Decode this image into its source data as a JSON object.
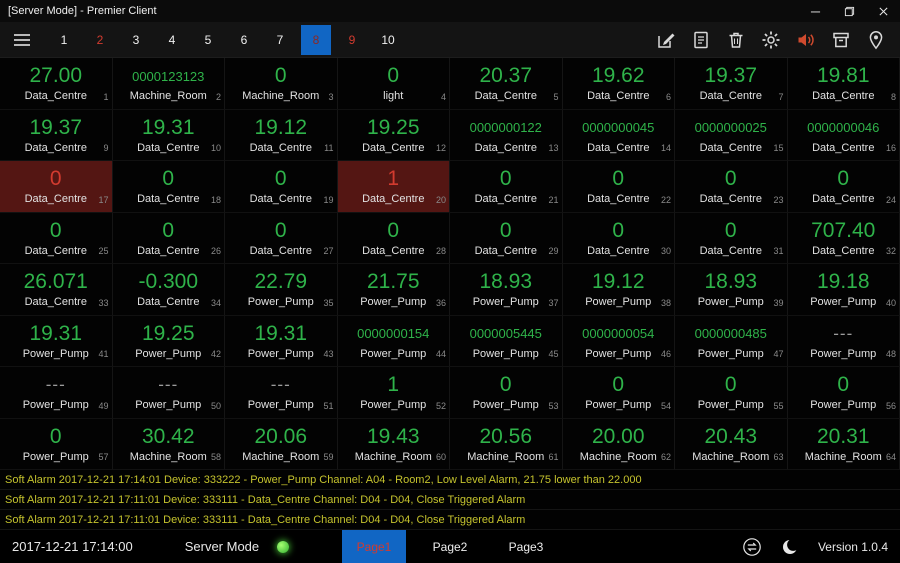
{
  "window": {
    "title": "[Server Mode] - Premier Client"
  },
  "toolbar": {
    "tabs": [
      {
        "label": "1",
        "alarm": false,
        "selected": false
      },
      {
        "label": "2",
        "alarm": true,
        "selected": false
      },
      {
        "label": "3",
        "alarm": false,
        "selected": false
      },
      {
        "label": "4",
        "alarm": false,
        "selected": false
      },
      {
        "label": "5",
        "alarm": false,
        "selected": false
      },
      {
        "label": "6",
        "alarm": false,
        "selected": false
      },
      {
        "label": "7",
        "alarm": false,
        "selected": false
      },
      {
        "label": "8",
        "alarm": true,
        "selected": true
      },
      {
        "label": "9",
        "alarm": true,
        "selected": false
      },
      {
        "label": "10",
        "alarm": false,
        "selected": false
      }
    ],
    "icons": [
      "edit-icon",
      "note-icon",
      "delete-icon",
      "settings-icon",
      "sound-icon",
      "archive-icon",
      "location-icon"
    ]
  },
  "grid": {
    "cells": [
      {
        "value": "27.00",
        "label": "Data_Centre",
        "index": "1",
        "state": "normal"
      },
      {
        "value": "0000123123",
        "label": "Machine_Room",
        "index": "2",
        "state": "normal"
      },
      {
        "value": "0",
        "label": "Machine_Room",
        "index": "3",
        "state": "normal"
      },
      {
        "value": "0",
        "label": "light",
        "index": "4",
        "state": "normal"
      },
      {
        "value": "20.37",
        "label": "Data_Centre",
        "index": "5",
        "state": "normal"
      },
      {
        "value": "19.62",
        "label": "Data_Centre",
        "index": "6",
        "state": "normal"
      },
      {
        "value": "19.37",
        "label": "Data_Centre",
        "index": "7",
        "state": "normal"
      },
      {
        "value": "19.81",
        "label": "Data_Centre",
        "index": "8",
        "state": "normal"
      },
      {
        "value": "19.37",
        "label": "Data_Centre",
        "index": "9",
        "state": "normal"
      },
      {
        "value": "19.31",
        "label": "Data_Centre",
        "index": "10",
        "state": "normal"
      },
      {
        "value": "19.12",
        "label": "Data_Centre",
        "index": "11",
        "state": "normal"
      },
      {
        "value": "19.25",
        "label": "Data_Centre",
        "index": "12",
        "state": "normal"
      },
      {
        "value": "0000000122",
        "label": "Data_Centre",
        "index": "13",
        "state": "normal"
      },
      {
        "value": "0000000045",
        "label": "Data_Centre",
        "index": "14",
        "state": "normal"
      },
      {
        "value": "0000000025",
        "label": "Data_Centre",
        "index": "15",
        "state": "normal"
      },
      {
        "value": "0000000046",
        "label": "Data_Centre",
        "index": "16",
        "state": "normal"
      },
      {
        "value": "0",
        "label": "Data_Centre",
        "index": "17",
        "state": "alarm"
      },
      {
        "value": "0",
        "label": "Data_Centre",
        "index": "18",
        "state": "normal"
      },
      {
        "value": "0",
        "label": "Data_Centre",
        "index": "19",
        "state": "normal"
      },
      {
        "value": "1",
        "label": "Data_Centre",
        "index": "20",
        "state": "alarm"
      },
      {
        "value": "0",
        "label": "Data_Centre",
        "index": "21",
        "state": "normal"
      },
      {
        "value": "0",
        "label": "Data_Centre",
        "index": "22",
        "state": "normal"
      },
      {
        "value": "0",
        "label": "Data_Centre",
        "index": "23",
        "state": "normal"
      },
      {
        "value": "0",
        "label": "Data_Centre",
        "index": "24",
        "state": "normal"
      },
      {
        "value": "0",
        "label": "Data_Centre",
        "index": "25",
        "state": "normal"
      },
      {
        "value": "0",
        "label": "Data_Centre",
        "index": "26",
        "state": "normal"
      },
      {
        "value": "0",
        "label": "Data_Centre",
        "index": "27",
        "state": "normal"
      },
      {
        "value": "0",
        "label": "Data_Centre",
        "index": "28",
        "state": "normal"
      },
      {
        "value": "0",
        "label": "Data_Centre",
        "index": "29",
        "state": "normal"
      },
      {
        "value": "0",
        "label": "Data_Centre",
        "index": "30",
        "state": "normal"
      },
      {
        "value": "0",
        "label": "Data_Centre",
        "index": "31",
        "state": "normal"
      },
      {
        "value": "707.40",
        "label": "Data_Centre",
        "index": "32",
        "state": "normal"
      },
      {
        "value": "26.071",
        "label": "Data_Centre",
        "index": "33",
        "state": "normal"
      },
      {
        "value": "-0.300",
        "label": "Data_Centre",
        "index": "34",
        "state": "normal"
      },
      {
        "value": "22.79",
        "label": "Power_Pump",
        "index": "35",
        "state": "normal"
      },
      {
        "value": "21.75",
        "label": "Power_Pump",
        "index": "36",
        "state": "normal"
      },
      {
        "value": "18.93",
        "label": "Power_Pump",
        "index": "37",
        "state": "normal"
      },
      {
        "value": "19.12",
        "label": "Power_Pump",
        "index": "38",
        "state": "normal"
      },
      {
        "value": "18.93",
        "label": "Power_Pump",
        "index": "39",
        "state": "normal"
      },
      {
        "value": "19.18",
        "label": "Power_Pump",
        "index": "40",
        "state": "normal"
      },
      {
        "value": "19.31",
        "label": "Power_Pump",
        "index": "41",
        "state": "normal"
      },
      {
        "value": "19.25",
        "label": "Power_Pump",
        "index": "42",
        "state": "normal"
      },
      {
        "value": "19.31",
        "label": "Power_Pump",
        "index": "43",
        "state": "normal"
      },
      {
        "value": "0000000154",
        "label": "Power_Pump",
        "index": "44",
        "state": "normal"
      },
      {
        "value": "0000005445",
        "label": "Power_Pump",
        "index": "45",
        "state": "normal"
      },
      {
        "value": "0000000054",
        "label": "Power_Pump",
        "index": "46",
        "state": "normal"
      },
      {
        "value": "0000000485",
        "label": "Power_Pump",
        "index": "47",
        "state": "normal"
      },
      {
        "value": "---",
        "label": "Power_Pump",
        "index": "48",
        "state": "offline"
      },
      {
        "value": "---",
        "label": "Power_Pump",
        "index": "49",
        "state": "offline"
      },
      {
        "value": "---",
        "label": "Power_Pump",
        "index": "50",
        "state": "offline"
      },
      {
        "value": "---",
        "label": "Power_Pump",
        "index": "51",
        "state": "offline"
      },
      {
        "value": "1",
        "label": "Power_Pump",
        "index": "52",
        "state": "normal"
      },
      {
        "value": "0",
        "label": "Power_Pump",
        "index": "53",
        "state": "normal"
      },
      {
        "value": "0",
        "label": "Power_Pump",
        "index": "54",
        "state": "normal"
      },
      {
        "value": "0",
        "label": "Power_Pump",
        "index": "55",
        "state": "normal"
      },
      {
        "value": "0",
        "label": "Power_Pump",
        "index": "56",
        "state": "normal"
      },
      {
        "value": "0",
        "label": "Power_Pump",
        "index": "57",
        "state": "normal"
      },
      {
        "value": "30.42",
        "label": "Machine_Room",
        "index": "58",
        "state": "normal"
      },
      {
        "value": "20.06",
        "label": "Machine_Room",
        "index": "59",
        "state": "normal"
      },
      {
        "value": "19.43",
        "label": "Machine_Room",
        "index": "60",
        "state": "normal"
      },
      {
        "value": "20.56",
        "label": "Machine_Room",
        "index": "61",
        "state": "normal"
      },
      {
        "value": "20.00",
        "label": "Machine_Room",
        "index": "62",
        "state": "normal"
      },
      {
        "value": "20.43",
        "label": "Machine_Room",
        "index": "63",
        "state": "normal"
      },
      {
        "value": "20.31",
        "label": "Machine_Room",
        "index": "64",
        "state": "normal"
      }
    ]
  },
  "alarms": [
    "Soft Alarm 2017-12-21 17:14:01 Device: 333222 - Power_Pump Channel: A04 - Room2, Low Level Alarm, 21.75 lower than 22.000",
    "Soft Alarm 2017-12-21 17:11:01 Device: 333111 - Data_Centre Channel: D04 - D04, Close Triggered Alarm",
    "Soft Alarm 2017-12-21 17:11:01 Device: 333111 - Data_Centre Channel: D04 - D04, Close Triggered Alarm"
  ],
  "statusbar": {
    "datetime": "2017-12-21 17:14:00",
    "mode_label": "Server Mode",
    "pages": [
      {
        "label": "Page1",
        "selected": true
      },
      {
        "label": "Page2",
        "selected": false
      },
      {
        "label": "Page3",
        "selected": false
      }
    ],
    "version": "Version 1.0.4"
  },
  "colors": {
    "value-green": "#2fb34a",
    "alarm-red": "#d23b2f",
    "alarm-cell-bg": "#541613",
    "selected-blue": "#1166c4",
    "alarm-text-yellow": "#c5c32e",
    "status-dot-green": "#2fae2f"
  }
}
